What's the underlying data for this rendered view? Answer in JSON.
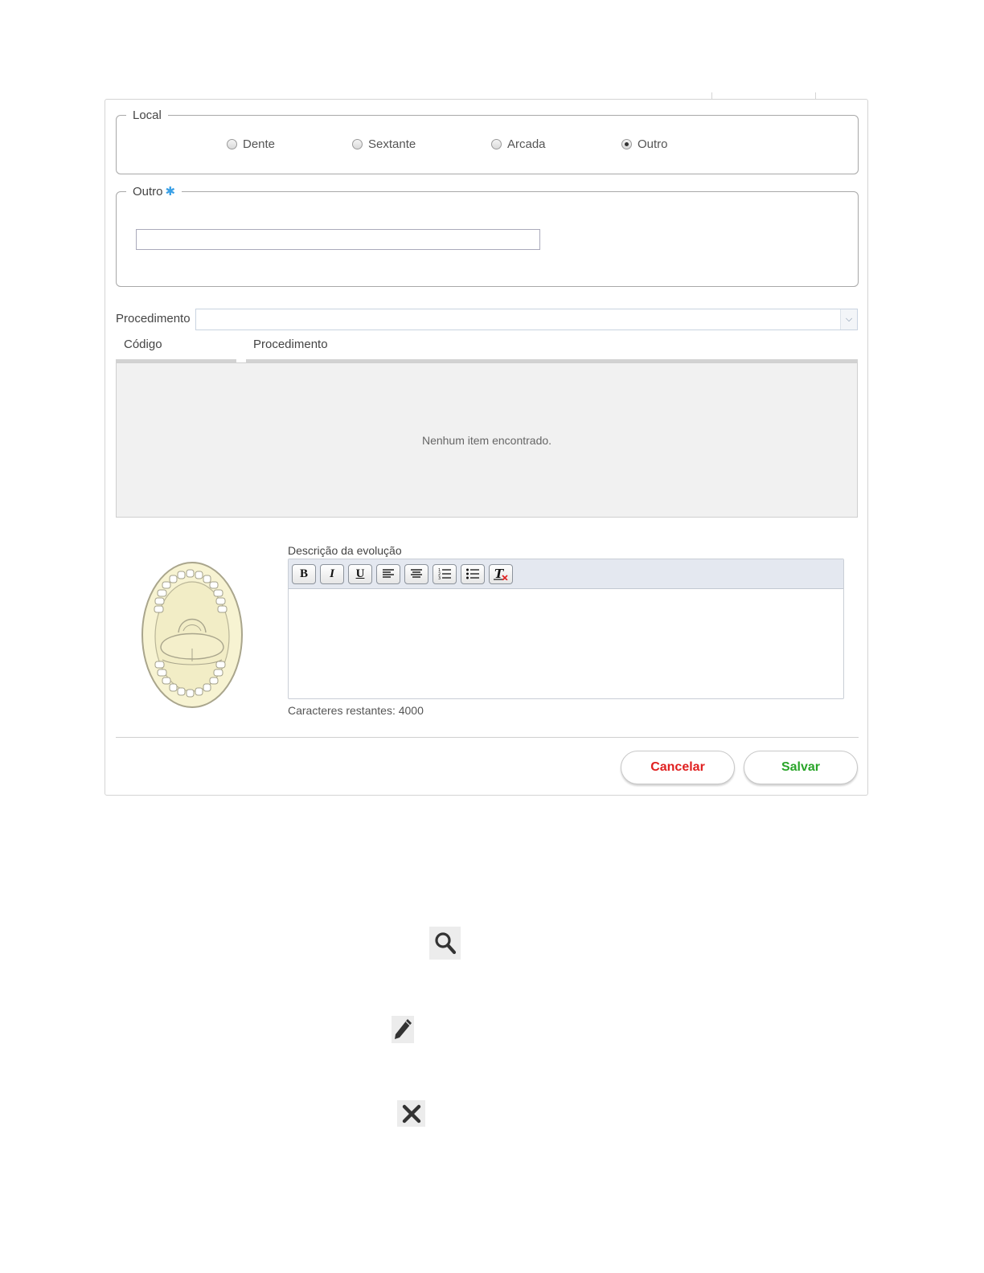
{
  "local": {
    "legend": "Local",
    "options": [
      {
        "label": "Dente",
        "checked": false
      },
      {
        "label": "Sextante",
        "checked": false
      },
      {
        "label": "Arcada",
        "checked": false
      },
      {
        "label": "Outro",
        "checked": true
      }
    ]
  },
  "outro": {
    "legend": "Outro",
    "required_mark": "✱",
    "value": ""
  },
  "procedimento": {
    "label": "Procedimento",
    "selected": ""
  },
  "grid": {
    "columns": [
      "Código",
      "Procedimento"
    ],
    "rows": [],
    "empty_message": "Nenhum item encontrado."
  },
  "descricao": {
    "label": "Descrição da evolução",
    "toolbar": [
      "bold",
      "italic",
      "underline",
      "align-left",
      "align-center",
      "ordered-list",
      "unordered-list",
      "remove-format"
    ],
    "toolbar_glyphs": {
      "bold": "B",
      "italic": "I",
      "underline": "U"
    },
    "value": "",
    "chars_remaining": "Caracteres restantes: 4000"
  },
  "actions": {
    "cancel_label": "Cancelar",
    "save_label": "Salvar"
  },
  "colors": {
    "cancel": "#e02020",
    "save": "#2aa52a",
    "required": "#3aa0e6"
  },
  "icons": [
    "search-icon",
    "pencil-icon",
    "close-icon"
  ]
}
